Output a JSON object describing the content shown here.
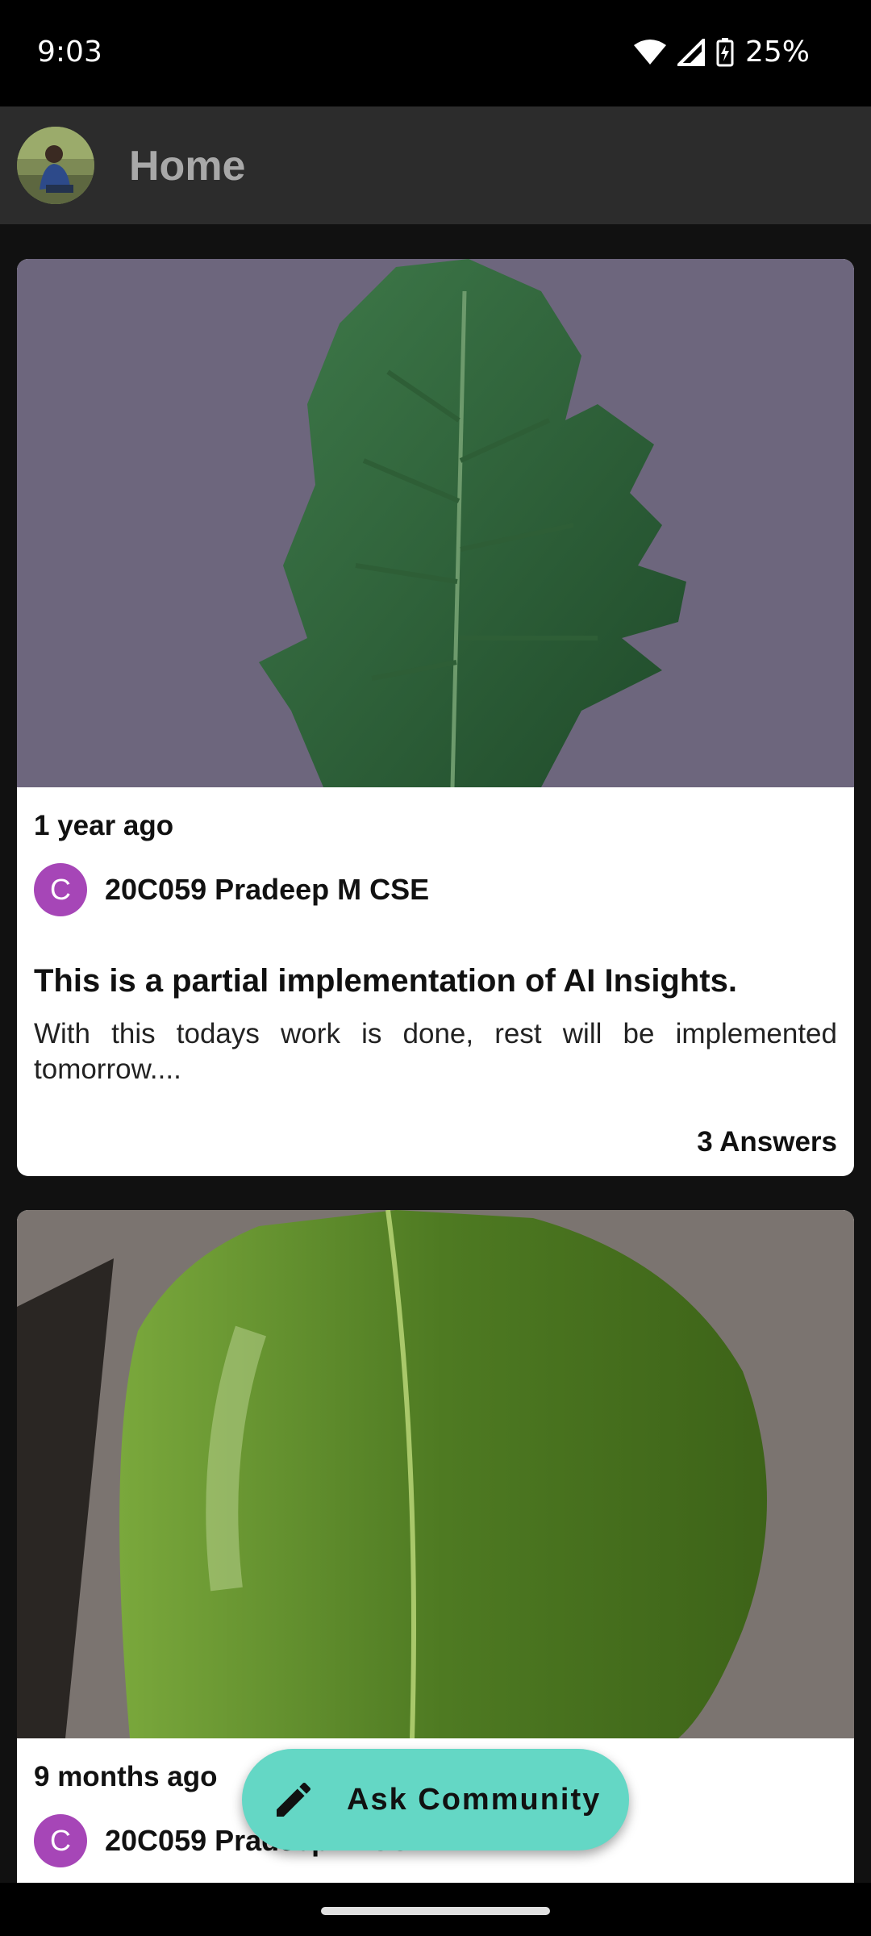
{
  "status_bar": {
    "time": "9:03",
    "battery": "25%",
    "icons": [
      "wifi-icon",
      "cell-signal-icon",
      "battery-charging-icon"
    ]
  },
  "app_bar": {
    "title": "Home",
    "avatar": "user-avatar-photo"
  },
  "posts": [
    {
      "time_ago": "1 year ago",
      "author_initial": "C",
      "author_name": "20C059 Pradeep M CSE",
      "title": "This is a partial implementation of AI Insights.",
      "description": "With this todays work is done, rest will be implemented tomorrow....",
      "answers": "3 Answers",
      "image": "tomato-leaf-photo"
    },
    {
      "time_ago": "9 months ago",
      "author_initial": "C",
      "author_name": "20C059 Pradeep M CSE",
      "image": "green-leaf-photo"
    }
  ],
  "fab": {
    "label": "Ask Community",
    "icon": "pencil-icon"
  },
  "colors": {
    "accent": "#64d7c5",
    "author_avatar": "#a646b7",
    "app_bar": "#2c2c2c",
    "background": "#111111"
  }
}
